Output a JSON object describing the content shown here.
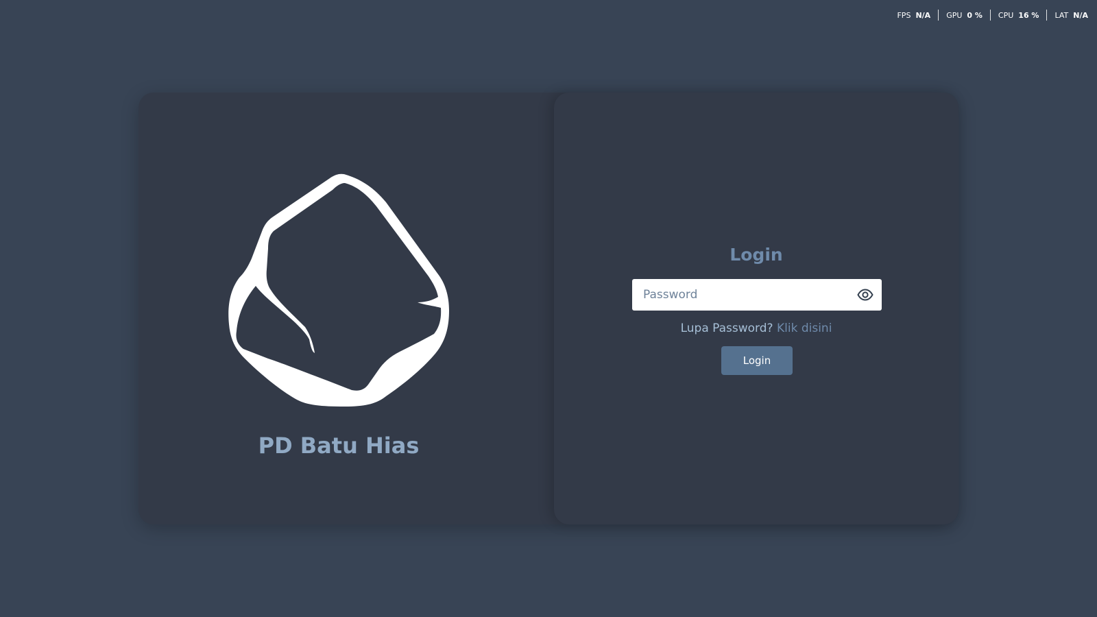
{
  "perf": {
    "fps_label": "FPS",
    "fps_value": "N/A",
    "gpu_label": "GPU",
    "gpu_value": "0 %",
    "cpu_label": "CPU",
    "cpu_value": "16 %",
    "lat_label": "LAT",
    "lat_value": "N/A"
  },
  "brand": {
    "name": "PD Batu Hias",
    "logo_icon": "stone-logo-icon"
  },
  "login": {
    "title": "Login",
    "password_placeholder": "Password",
    "password_value": "",
    "toggle_icon": "eye-icon",
    "forgot_text": "Lupa Password?",
    "forgot_link": "Klik disini",
    "button_label": "Login"
  },
  "colors": {
    "background": "#384455",
    "card": "#333a48",
    "accent": "#6f8bab",
    "brand_text": "#90a9c4",
    "button": "#55718f"
  }
}
